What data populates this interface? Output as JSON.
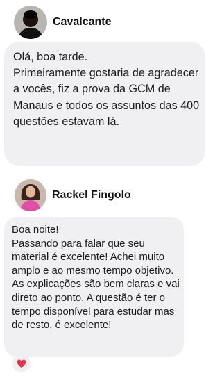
{
  "comments": [
    {
      "author": "Cavalcante",
      "avatar_icon": "profile-photo-icon",
      "text": "Olá, boa tarde.\nPrimeiramente gostaria de agradecer a vocês, fiz a prova da GCM de Manaus e todos os assuntos das 400 questões estavam lá."
    },
    {
      "author": "Rackel Fingolo",
      "avatar_icon": "profile-photo-icon",
      "text": "Boa noite!\nPassando para falar que seu material é excelente! Achei muito amplo e ao mesmo tempo objetivo. As explicações são bem claras e vai direto ao ponto. A questão é ter o tempo disponível para estudar mas de resto, é excelente!",
      "reaction": "heart-icon"
    }
  ],
  "colors": {
    "bubble": "#f0f0f2",
    "text": "#1c1c1c",
    "heart": "#e8344b"
  }
}
